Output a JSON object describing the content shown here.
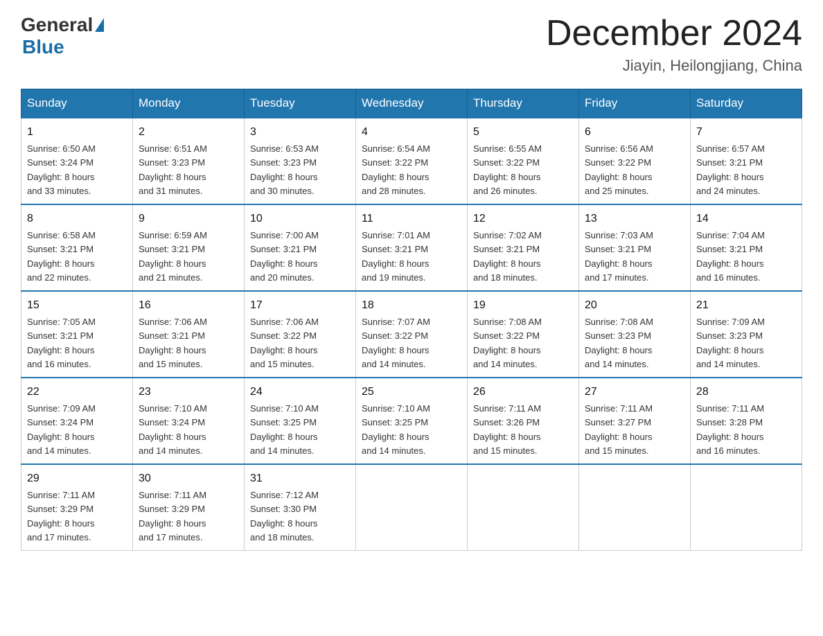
{
  "header": {
    "logo_general": "General",
    "logo_blue": "Blue",
    "month_title": "December 2024",
    "location": "Jiayin, Heilongjiang, China"
  },
  "days_of_week": [
    "Sunday",
    "Monday",
    "Tuesday",
    "Wednesday",
    "Thursday",
    "Friday",
    "Saturday"
  ],
  "weeks": [
    [
      {
        "day": "1",
        "sunrise": "6:50 AM",
        "sunset": "3:24 PM",
        "daylight": "8 hours and 33 minutes."
      },
      {
        "day": "2",
        "sunrise": "6:51 AM",
        "sunset": "3:23 PM",
        "daylight": "8 hours and 31 minutes."
      },
      {
        "day": "3",
        "sunrise": "6:53 AM",
        "sunset": "3:23 PM",
        "daylight": "8 hours and 30 minutes."
      },
      {
        "day": "4",
        "sunrise": "6:54 AM",
        "sunset": "3:22 PM",
        "daylight": "8 hours and 28 minutes."
      },
      {
        "day": "5",
        "sunrise": "6:55 AM",
        "sunset": "3:22 PM",
        "daylight": "8 hours and 26 minutes."
      },
      {
        "day": "6",
        "sunrise": "6:56 AM",
        "sunset": "3:22 PM",
        "daylight": "8 hours and 25 minutes."
      },
      {
        "day": "7",
        "sunrise": "6:57 AM",
        "sunset": "3:21 PM",
        "daylight": "8 hours and 24 minutes."
      }
    ],
    [
      {
        "day": "8",
        "sunrise": "6:58 AM",
        "sunset": "3:21 PM",
        "daylight": "8 hours and 22 minutes."
      },
      {
        "day": "9",
        "sunrise": "6:59 AM",
        "sunset": "3:21 PM",
        "daylight": "8 hours and 21 minutes."
      },
      {
        "day": "10",
        "sunrise": "7:00 AM",
        "sunset": "3:21 PM",
        "daylight": "8 hours and 20 minutes."
      },
      {
        "day": "11",
        "sunrise": "7:01 AM",
        "sunset": "3:21 PM",
        "daylight": "8 hours and 19 minutes."
      },
      {
        "day": "12",
        "sunrise": "7:02 AM",
        "sunset": "3:21 PM",
        "daylight": "8 hours and 18 minutes."
      },
      {
        "day": "13",
        "sunrise": "7:03 AM",
        "sunset": "3:21 PM",
        "daylight": "8 hours and 17 minutes."
      },
      {
        "day": "14",
        "sunrise": "7:04 AM",
        "sunset": "3:21 PM",
        "daylight": "8 hours and 16 minutes."
      }
    ],
    [
      {
        "day": "15",
        "sunrise": "7:05 AM",
        "sunset": "3:21 PM",
        "daylight": "8 hours and 16 minutes."
      },
      {
        "day": "16",
        "sunrise": "7:06 AM",
        "sunset": "3:21 PM",
        "daylight": "8 hours and 15 minutes."
      },
      {
        "day": "17",
        "sunrise": "7:06 AM",
        "sunset": "3:22 PM",
        "daylight": "8 hours and 15 minutes."
      },
      {
        "day": "18",
        "sunrise": "7:07 AM",
        "sunset": "3:22 PM",
        "daylight": "8 hours and 14 minutes."
      },
      {
        "day": "19",
        "sunrise": "7:08 AM",
        "sunset": "3:22 PM",
        "daylight": "8 hours and 14 minutes."
      },
      {
        "day": "20",
        "sunrise": "7:08 AM",
        "sunset": "3:23 PM",
        "daylight": "8 hours and 14 minutes."
      },
      {
        "day": "21",
        "sunrise": "7:09 AM",
        "sunset": "3:23 PM",
        "daylight": "8 hours and 14 minutes."
      }
    ],
    [
      {
        "day": "22",
        "sunrise": "7:09 AM",
        "sunset": "3:24 PM",
        "daylight": "8 hours and 14 minutes."
      },
      {
        "day": "23",
        "sunrise": "7:10 AM",
        "sunset": "3:24 PM",
        "daylight": "8 hours and 14 minutes."
      },
      {
        "day": "24",
        "sunrise": "7:10 AM",
        "sunset": "3:25 PM",
        "daylight": "8 hours and 14 minutes."
      },
      {
        "day": "25",
        "sunrise": "7:10 AM",
        "sunset": "3:25 PM",
        "daylight": "8 hours and 14 minutes."
      },
      {
        "day": "26",
        "sunrise": "7:11 AM",
        "sunset": "3:26 PM",
        "daylight": "8 hours and 15 minutes."
      },
      {
        "day": "27",
        "sunrise": "7:11 AM",
        "sunset": "3:27 PM",
        "daylight": "8 hours and 15 minutes."
      },
      {
        "day": "28",
        "sunrise": "7:11 AM",
        "sunset": "3:28 PM",
        "daylight": "8 hours and 16 minutes."
      }
    ],
    [
      {
        "day": "29",
        "sunrise": "7:11 AM",
        "sunset": "3:29 PM",
        "daylight": "8 hours and 17 minutes."
      },
      {
        "day": "30",
        "sunrise": "7:11 AM",
        "sunset": "3:29 PM",
        "daylight": "8 hours and 17 minutes."
      },
      {
        "day": "31",
        "sunrise": "7:12 AM",
        "sunset": "3:30 PM",
        "daylight": "8 hours and 18 minutes."
      },
      null,
      null,
      null,
      null
    ]
  ],
  "labels": {
    "sunrise": "Sunrise:",
    "sunset": "Sunset:",
    "daylight": "Daylight:"
  }
}
